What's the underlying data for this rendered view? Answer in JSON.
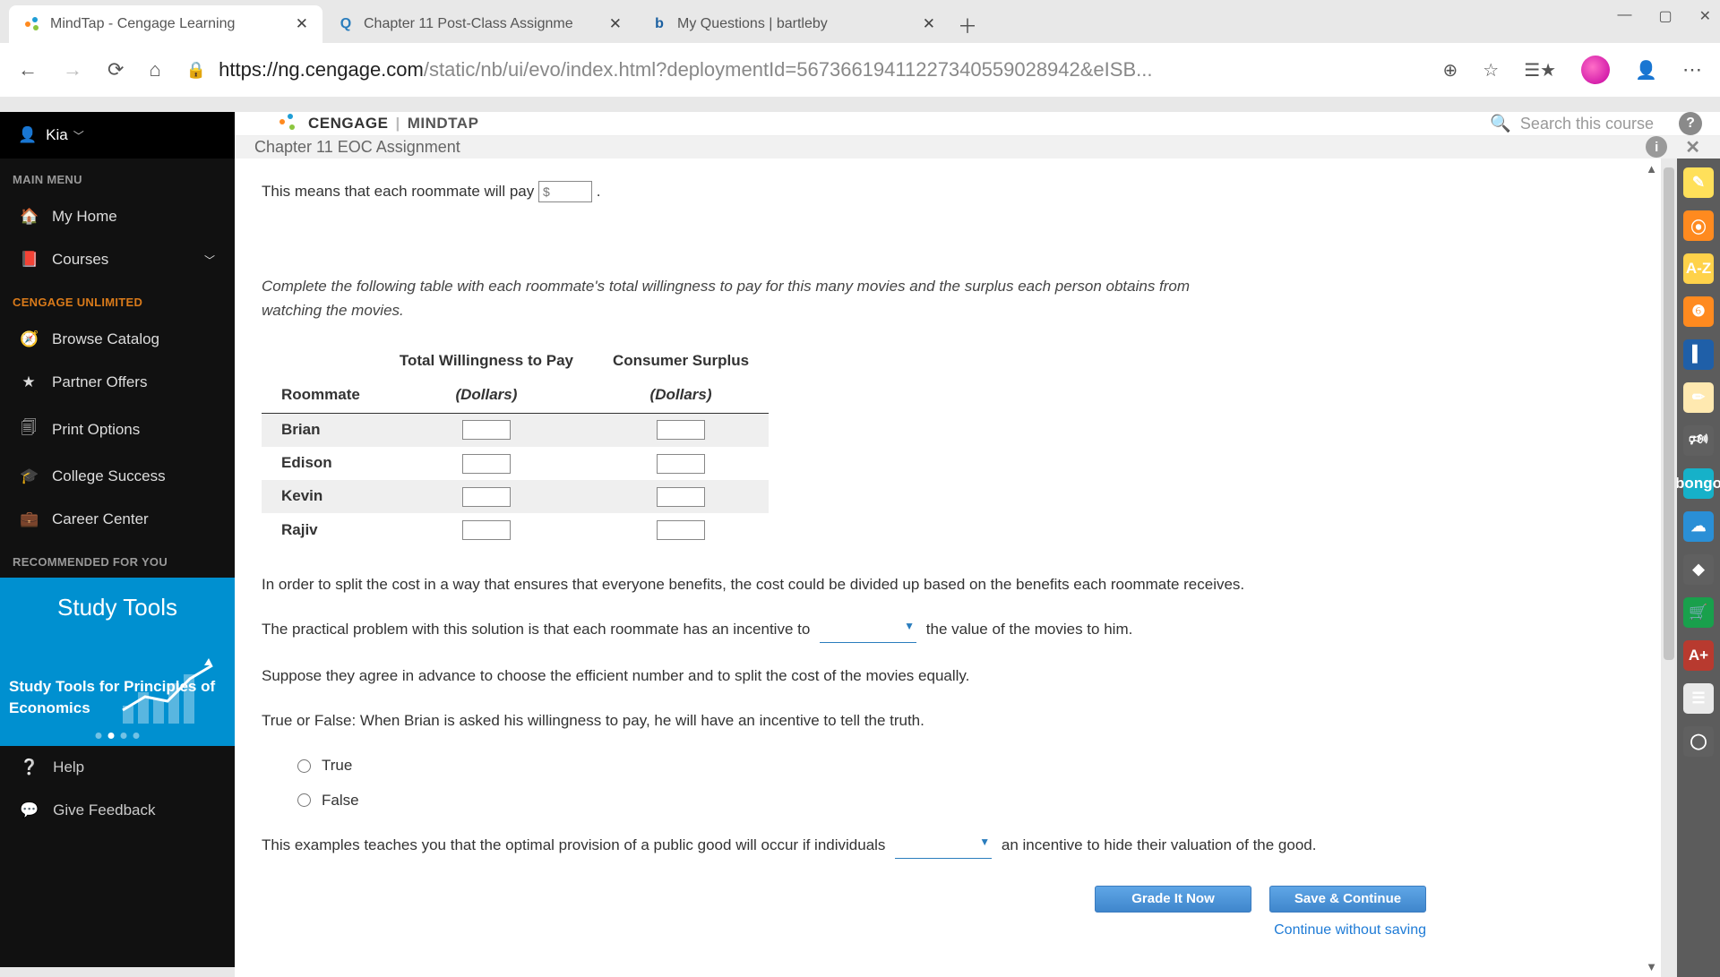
{
  "browser": {
    "tabs": [
      {
        "title": "MindTap - Cengage Learning",
        "active": true
      },
      {
        "title": "Chapter 11 Post-Class Assignme",
        "active": false
      },
      {
        "title": "My Questions | bartleby",
        "active": false
      }
    ],
    "url_host": "https://ng.cengage.com",
    "url_path": "/static/nb/ui/evo/index.html?deploymentId=56736619411227340559028942&eISB..."
  },
  "user": {
    "name": "Kia"
  },
  "sidebar": {
    "main_menu_label": "MAIN MENU",
    "items": {
      "home": "My Home",
      "courses": "Courses"
    },
    "unlimited_label": "CENGAGE UNLIMITED",
    "unlimited_items": {
      "browse": "Browse Catalog",
      "offers": "Partner Offers",
      "print": "Print Options",
      "college": "College Success",
      "career": "Career Center"
    },
    "recommended_label": "RECOMMENDED FOR YOU",
    "promo": {
      "title": "Study Tools",
      "subtitle": "Study Tools for Principles of Economics"
    },
    "help": "Help",
    "feedback": "Give Feedback"
  },
  "brand": {
    "left": "CENGAGE",
    "right": "MINDTAP"
  },
  "search_placeholder": "Search this course",
  "chapter_title": "Chapter 11 EOC Assignment",
  "content": {
    "pay_line_pre": "This means that each roommate will pay ",
    "pay_line_post": " .",
    "pay_prefix": "$",
    "table_intro": "Complete the following table with each roommate's total willingness to pay for this many movies and the surplus each person obtains from watching the movies.",
    "table": {
      "col_roommate": "Roommate",
      "col_twp": "Total Willingness to Pay",
      "col_cs": "Consumer Surplus",
      "unit": "(Dollars)",
      "rows": [
        "Brian",
        "Edison",
        "Kevin",
        "Rajiv"
      ]
    },
    "split_line": "In order to split the cost in a way that ensures that everyone benefits, the cost could be divided up based on the benefits each roommate receives.",
    "practical_pre": "The practical problem with this solution is that each roommate has an incentive to ",
    "practical_post": " the value of the movies to him.",
    "suppose_line": "Suppose they agree in advance to choose the efficient number and to split the cost of the movies equally.",
    "tf_line": "True or False: When Brian is asked his willingness to pay, he will have an incentive to tell the truth.",
    "opt_true": "True",
    "opt_false": "False",
    "example_pre": "This examples teaches you that the optimal provision of a public good will occur if individuals ",
    "example_post": " an incentive to hide their valuation of the good.",
    "grade_btn": "Grade It Now",
    "save_btn": "Save & Continue",
    "skip_link": "Continue without saving"
  },
  "rail": {
    "az": "A-Z",
    "bongo": "bongo",
    "aplus": "A+"
  }
}
